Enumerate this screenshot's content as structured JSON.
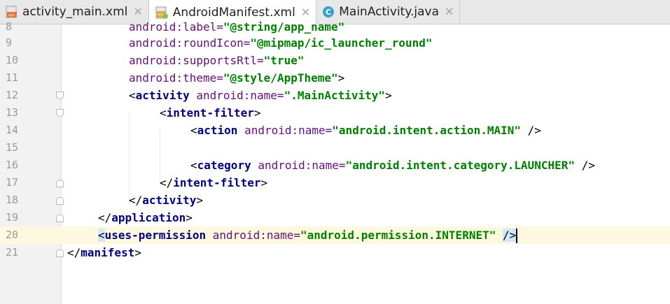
{
  "tabs": [
    {
      "label": "activity_main.xml",
      "icon": "xml-layout-icon",
      "active": false
    },
    {
      "label": "AndroidManifest.xml",
      "icon": "manifest-icon",
      "active": true
    },
    {
      "label": "MainActivity.java",
      "icon": "java-class-icon",
      "active": false
    }
  ],
  "close_glyph": "✕",
  "colors": {
    "tag": "#000080",
    "attribute": "#660e7a",
    "value": "#008000",
    "current_line": "#fdf8de"
  },
  "lines": [
    {
      "num": "8",
      "tokens": [
        "android",
        ":label=",
        "\"@string/app_name\""
      ]
    },
    {
      "num": "9",
      "tokens": [
        "android",
        ":roundIcon=",
        "\"@mipmap/ic_launcher_round\""
      ]
    },
    {
      "num": "10",
      "tokens": [
        "android",
        ":supportsRtl=",
        "\"true\""
      ]
    },
    {
      "num": "11",
      "tokens": [
        "android",
        ":theme=",
        "\"@style/AppTheme\"",
        ">"
      ]
    },
    {
      "num": "12",
      "tokens": [
        "<",
        "activity",
        " android:name=",
        "\".MainActivity\"",
        ">"
      ]
    },
    {
      "num": "13",
      "tokens": [
        "<",
        "intent-filter",
        ">"
      ]
    },
    {
      "num": "14",
      "tokens": [
        "<",
        "action",
        " android:name=",
        "\"android.intent.action.MAIN\"",
        " />"
      ]
    },
    {
      "num": "15",
      "tokens": []
    },
    {
      "num": "16",
      "tokens": [
        "<",
        "category",
        " android:name=",
        "\"android.intent.category.LAUNCHER\"",
        " />"
      ]
    },
    {
      "num": "17",
      "tokens": [
        "</",
        "intent-filter",
        ">"
      ]
    },
    {
      "num": "18",
      "tokens": [
        "</",
        "activity",
        ">"
      ]
    },
    {
      "num": "19",
      "tokens": [
        "</",
        "application",
        ">"
      ]
    },
    {
      "num": "20",
      "tokens": [
        "<",
        "uses-permission",
        " android:name=",
        "\"android.permission.INTERNET\"",
        " ",
        "/>"
      ]
    },
    {
      "num": "21",
      "tokens": [
        "</",
        "manifest",
        ">"
      ]
    }
  ]
}
